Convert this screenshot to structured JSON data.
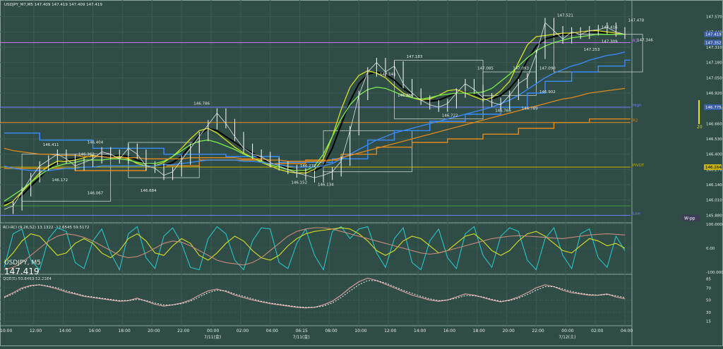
{
  "chart_data": {
    "type": "line",
    "symbol_line": "USDJPY_M7,M5  147.409 147.419 147.409 147.419",
    "symbol": "USDJPY, M5",
    "last_price": "147.419",
    "colors": {
      "background": "#2f4d46",
      "grid": "#3d5a53",
      "text": "#e8ece8",
      "price": "#ffffff",
      "high_line": "#6f7fff",
      "pivot_line": "#c9b400",
      "low_line": "#6f7fff",
      "s_line": "#3d9b3d",
      "r_line": "#c77dff",
      "orange": "#e08a1e",
      "blue": "#3b8cff",
      "cyan": "#27c3c9",
      "yellow": "#d9e021",
      "green": "#7cf04a",
      "black": "#000000",
      "pink": "#d8a0a0"
    },
    "y_axis": {
      "ticks": [
        "147.570",
        "147.440",
        "147.310",
        "147.180",
        "147.050",
        "146.920",
        "146.790",
        "146.660",
        "146.530",
        "146.400",
        "146.270",
        "146.140",
        "146.010",
        "145.880"
      ],
      "ylim": [
        145.84,
        147.64
      ]
    },
    "x_axis": {
      "ticks": [
        "10:00",
        "12:00",
        "14:00",
        "16:00",
        "18:00",
        "20:00",
        "22:00",
        "00:00",
        "02:00",
        "04:00",
        "06:15",
        "08:00",
        "10:00",
        "12:00",
        "14:00",
        "16:00",
        "18:00",
        "20:00",
        "22:00",
        "00:00",
        "02:00",
        "04:00"
      ],
      "date_labels": [
        {
          "text": "7/11(金)",
          "at": 7
        },
        {
          "text": "7/11(金)",
          "at": 10
        },
        {
          "text": "7/12(土)",
          "at": 19
        }
      ]
    },
    "price": [
      145.93,
      145.96,
      146.08,
      146.2,
      146.3,
      146.35,
      146.4,
      146.36,
      146.3,
      146.33,
      146.36,
      146.42,
      146.4,
      146.36,
      146.45,
      146.4,
      146.3,
      146.28,
      146.22,
      146.25,
      146.35,
      146.45,
      146.55,
      146.65,
      146.75,
      146.66,
      146.55,
      146.45,
      146.4,
      146.38,
      146.33,
      146.3,
      146.27,
      146.24,
      146.22,
      146.2,
      146.22,
      146.25,
      146.34,
      146.6,
      146.9,
      147.1,
      147.18,
      147.1,
      147.15,
      147.0,
      146.92,
      146.86,
      146.82,
      146.8,
      146.83,
      146.92,
      147.0,
      146.95,
      146.88,
      146.84,
      146.82,
      146.9,
      147.0,
      147.05,
      147.25,
      147.52,
      147.45,
      147.38,
      147.44,
      147.42,
      147.45,
      147.46,
      147.48,
      147.44,
      147.42
    ],
    "emas": [
      {
        "name": "",
        "color": "#000000",
        "values": [
          145.98,
          146.0,
          146.05,
          146.13,
          146.2,
          146.28,
          146.33,
          146.35,
          146.36,
          146.37,
          146.39,
          146.39,
          146.38,
          146.39,
          146.38,
          146.35,
          146.32,
          146.3,
          146.3,
          146.33,
          146.38,
          146.47,
          146.56,
          146.62,
          146.6,
          146.55,
          146.5,
          146.45,
          146.41,
          146.36,
          146.33,
          146.3,
          146.28,
          146.26,
          146.25,
          146.26,
          146.3,
          146.45,
          146.65,
          146.85,
          147.0,
          147.08,
          147.1,
          147.08,
          147.03,
          146.96,
          146.91,
          146.87,
          146.85,
          146.86,
          146.89,
          146.92,
          146.93,
          146.91,
          146.88,
          146.87,
          146.9,
          146.96,
          147.05,
          147.2,
          147.32,
          147.38,
          147.4,
          147.42,
          147.42,
          147.43,
          147.44,
          147.44,
          147.43,
          147.43,
          147.42
        ]
      },
      {
        "name": "",
        "color": "#d9e021",
        "values": [
          145.96,
          146.0,
          146.08,
          146.16,
          146.24,
          146.3,
          146.34,
          146.34,
          146.35,
          146.37,
          146.39,
          146.38,
          146.37,
          146.38,
          146.36,
          146.32,
          146.3,
          146.3,
          146.33,
          146.38,
          146.45,
          146.53,
          146.6,
          146.62,
          146.58,
          146.52,
          146.46,
          146.41,
          146.37,
          146.33,
          146.3,
          146.27,
          146.25,
          146.24,
          146.24,
          146.27,
          146.36,
          146.55,
          146.78,
          146.97,
          147.07,
          147.11,
          147.09,
          147.05,
          146.98,
          146.92,
          146.88,
          146.86,
          146.87,
          146.9,
          146.94,
          146.95,
          146.92,
          146.89,
          146.86,
          146.88,
          146.94,
          147.02,
          147.18,
          147.33,
          147.4,
          147.41,
          147.42,
          147.43,
          147.43,
          147.44,
          147.45,
          147.45,
          147.44,
          147.43,
          147.42
        ]
      },
      {
        "name": "",
        "color": "#7cf04a",
        "values": [
          146.0,
          146.05,
          146.1,
          146.16,
          146.22,
          146.27,
          146.3,
          146.32,
          146.33,
          146.35,
          146.35,
          146.35,
          146.36,
          146.36,
          146.35,
          146.33,
          146.32,
          146.32,
          146.34,
          146.38,
          146.43,
          146.48,
          146.51,
          146.52,
          146.5,
          146.47,
          146.44,
          146.4,
          146.37,
          146.34,
          146.31,
          146.29,
          146.27,
          146.26,
          146.26,
          146.3,
          146.4,
          146.55,
          146.7,
          146.82,
          146.9,
          146.95,
          146.97,
          146.96,
          146.93,
          146.9,
          146.88,
          146.87,
          146.88,
          146.9,
          146.91,
          146.92,
          146.92,
          146.92,
          146.93,
          146.96,
          147.02,
          147.08,
          147.15,
          147.22,
          147.28,
          147.32,
          147.35,
          147.37,
          147.39,
          147.4,
          147.41,
          147.42,
          147.42,
          147.42,
          147.42
        ]
      },
      {
        "name": "",
        "color": "#3b8cff",
        "values": [
          146.3,
          146.28,
          146.27,
          146.26,
          146.26,
          146.26,
          146.27,
          146.28,
          146.28,
          146.29,
          146.29,
          146.3,
          146.3,
          146.3,
          146.3,
          146.3,
          146.3,
          146.3,
          146.31,
          146.31,
          146.32,
          146.33,
          146.34,
          146.35,
          146.35,
          146.35,
          146.35,
          146.34,
          146.34,
          146.33,
          146.32,
          146.31,
          146.3,
          146.29,
          146.29,
          146.29,
          146.3,
          146.32,
          146.36,
          146.4,
          146.44,
          146.48,
          146.52,
          146.55,
          146.58,
          146.6,
          146.62,
          146.64,
          146.66,
          146.68,
          146.7,
          146.72,
          146.74,
          146.76,
          146.78,
          146.8,
          146.83,
          146.86,
          146.9,
          146.95,
          147.0,
          147.05,
          147.09,
          147.12,
          147.15,
          147.17,
          147.2,
          147.22,
          147.24,
          147.25,
          147.27
        ]
      },
      {
        "name": "",
        "color": "#e08a1e",
        "values": [
          146.45,
          146.43,
          146.42,
          146.41,
          146.4,
          146.4,
          146.39,
          146.39,
          146.39,
          146.38,
          146.38,
          146.38,
          146.37,
          146.37,
          146.37,
          146.37,
          146.36,
          146.36,
          146.36,
          146.36,
          146.36,
          146.37,
          146.37,
          146.37,
          146.37,
          146.37,
          146.37,
          146.36,
          146.36,
          146.36,
          146.35,
          146.35,
          146.34,
          146.34,
          146.34,
          146.34,
          146.34,
          146.35,
          146.37,
          146.39,
          146.41,
          146.43,
          146.45,
          146.47,
          146.49,
          146.51,
          146.53,
          146.55,
          146.57,
          146.59,
          146.61,
          146.63,
          146.65,
          146.67,
          146.69,
          146.71,
          146.73,
          146.75,
          146.77,
          146.79,
          146.81,
          146.83,
          146.85,
          146.87,
          146.88,
          146.9,
          146.92,
          146.93,
          146.94,
          146.95,
          146.96
        ]
      }
    ],
    "step_lines": [
      {
        "color": "#3b8cff",
        "points": [
          [
            0,
            146.58
          ],
          [
            4,
            146.52
          ],
          [
            10,
            146.45
          ],
          [
            18,
            146.4
          ],
          [
            25,
            146.38
          ],
          [
            31,
            146.33
          ],
          [
            37,
            146.36
          ],
          [
            41,
            146.52
          ],
          [
            44,
            146.6
          ],
          [
            48,
            146.68
          ],
          [
            52,
            146.74
          ],
          [
            56,
            146.8
          ],
          [
            59,
            146.92
          ],
          [
            61,
            147.02
          ],
          [
            64,
            147.1
          ],
          [
            67,
            147.15
          ],
          [
            70,
            147.2
          ]
        ]
      },
      {
        "color": "#e08a1e",
        "points": [
          [
            0,
            146.28
          ],
          [
            8,
            146.26
          ],
          [
            16,
            146.3
          ],
          [
            22,
            146.35
          ],
          [
            30,
            146.32
          ],
          [
            34,
            146.35
          ],
          [
            38,
            146.4
          ],
          [
            42,
            146.46
          ],
          [
            46,
            146.5
          ],
          [
            50,
            146.53
          ],
          [
            54,
            146.57
          ],
          [
            58,
            146.62
          ],
          [
            62,
            146.67
          ],
          [
            66,
            146.7
          ],
          [
            70,
            146.7
          ]
        ]
      }
    ],
    "annotations": [
      {
        "text": "146.411",
        "x": 5,
        "y": 146.47
      },
      {
        "text": "146.172",
        "x": 6,
        "y": 146.17
      },
      {
        "text": "146.404",
        "x": 10,
        "y": 146.49
      },
      {
        "text": "146.362",
        "x": 9,
        "y": 146.39
      },
      {
        "text": "146.067",
        "x": 10,
        "y": 146.06
      },
      {
        "text": "146.684",
        "x": 16,
        "y": 146.08
      },
      {
        "text": "146.786",
        "x": 22,
        "y": 146.82
      },
      {
        "text": "146.272",
        "x": 34,
        "y": 146.29
      },
      {
        "text": "146.152",
        "x": 33,
        "y": 146.15
      },
      {
        "text": "146.134",
        "x": 36,
        "y": 146.13
      },
      {
        "text": "147.141",
        "x": 43,
        "y": 147.07
      },
      {
        "text": "146.860",
        "x": 45,
        "y": 146.89
      },
      {
        "text": "147.183",
        "x": 46,
        "y": 147.22
      },
      {
        "text": "146.722",
        "x": 50,
        "y": 146.72
      },
      {
        "text": "147.085",
        "x": 54,
        "y": 147.12
      },
      {
        "text": "146.766",
        "x": 56,
        "y": 146.76
      },
      {
        "text": "147.093",
        "x": 58,
        "y": 147.12
      },
      {
        "text": "146.789",
        "x": 59,
        "y": 146.78
      },
      {
        "text": "147.090",
        "x": 61,
        "y": 147.12
      },
      {
        "text": "146.902",
        "x": 61,
        "y": 146.92
      },
      {
        "text": "147.521",
        "x": 63,
        "y": 147.57
      },
      {
        "text": "147.253",
        "x": 66,
        "y": 147.28
      },
      {
        "text": "147.416",
        "x": 68,
        "y": 147.47
      },
      {
        "text": "147.309",
        "x": 68,
        "y": 147.35
      },
      {
        "text": "147.478",
        "x": 71,
        "y": 147.53
      },
      {
        "text": "147.346",
        "x": 72,
        "y": 147.36
      }
    ],
    "levels": [
      {
        "label": "R2",
        "value": 147.35,
        "color": "#c77dff"
      },
      {
        "label": "High",
        "value": 146.8,
        "color": "#6f7fff"
      },
      {
        "label": "R2",
        "value": 146.67,
        "color": "#e08a1e"
      },
      {
        "label": "PIVOT",
        "value": 146.29,
        "color": "#c9b400"
      },
      {
        "label": "Low",
        "value": 145.88,
        "color": "#6f7fff"
      },
      {
        "label": "",
        "value": 145.96,
        "color": "#3d9b3d"
      }
    ],
    "right_tags": [
      {
        "text": "147.419",
        "value": 147.42
      },
      {
        "text": "147.352",
        "value": 147.35
      },
      {
        "text": "146.775",
        "value": 146.8
      },
      {
        "text": "146.264",
        "value": 146.29
      }
    ],
    "w_pp_label": "W-pp",
    "level_20_label": "20",
    "rci_panel": {
      "title": "RCI-RCI (9,26,52) 13.1322 -12.6545 59.5172",
      "ticks": [
        "100.0000",
        "0.00",
        "-100.0000"
      ],
      "ylim": [
        -100,
        100
      ]
    },
    "qqe_panel": {
      "title": "QQE(5) 50.8463 52.2184",
      "ticks": [
        "85",
        "70",
        "50",
        "30",
        "15"
      ],
      "ylim": [
        10,
        90
      ],
      "line": [
        55,
        62,
        70,
        74,
        75,
        72,
        68,
        63,
        60,
        56,
        54,
        52,
        50,
        48,
        49,
        53,
        48,
        43,
        40,
        42,
        45,
        50,
        58,
        65,
        68,
        64,
        58,
        54,
        50,
        47,
        44,
        42,
        40,
        38,
        37,
        38,
        42,
        48,
        58,
        70,
        80,
        86,
        82,
        76,
        70,
        64,
        58,
        54,
        50,
        48,
        50,
        55,
        60,
        58,
        54,
        50,
        47,
        50,
        55,
        62,
        70,
        75,
        72,
        66,
        62,
        60,
        58,
        58,
        60,
        55,
        52
      ],
      "signal": [
        54,
        60,
        68,
        73,
        75,
        73,
        70,
        65,
        61,
        57,
        55,
        53,
        51,
        49,
        49,
        51,
        49,
        45,
        42,
        42,
        44,
        48,
        55,
        62,
        66,
        65,
        60,
        56,
        52,
        48,
        45,
        43,
        41,
        39,
        38,
        38,
        40,
        45,
        54,
        65,
        75,
        82,
        82,
        78,
        72,
        66,
        61,
        56,
        52,
        49,
        50,
        53,
        57,
        57,
        55,
        51,
        48,
        49,
        53,
        59,
        66,
        72,
        72,
        68,
        64,
        61,
        59,
        58,
        59,
        57,
        54
      ]
    },
    "rci_series": {
      "cyan": [
        -80,
        60,
        80,
        -50,
        -90,
        40,
        85,
        70,
        -60,
        -85,
        30,
        80,
        -20,
        -90,
        60,
        90,
        -40,
        -85,
        50,
        85,
        20,
        -80,
        -90,
        40,
        90,
        60,
        -50,
        -90,
        30,
        85,
        80,
        -60,
        -85,
        20,
        80,
        -30,
        -90,
        70,
        90,
        40,
        80,
        90,
        -20,
        -80,
        40,
        85,
        -60,
        -90,
        30,
        80,
        -40,
        -85,
        60,
        90,
        -30,
        -80,
        50,
        85,
        70,
        -50,
        -90,
        40,
        85,
        -30,
        -85,
        60,
        80,
        -40,
        -80,
        50,
        -10
      ],
      "yellow": [
        -60,
        -20,
        30,
        60,
        50,
        10,
        -30,
        -20,
        20,
        40,
        20,
        -20,
        -40,
        -10,
        40,
        60,
        30,
        -20,
        -30,
        10,
        40,
        20,
        -30,
        -50,
        -20,
        20,
        50,
        30,
        -10,
        -40,
        -50,
        -30,
        10,
        40,
        60,
        70,
        75,
        80,
        85,
        80,
        60,
        30,
        -10,
        -30,
        -10,
        30,
        50,
        40,
        10,
        -20,
        -10,
        20,
        50,
        60,
        30,
        -10,
        -30,
        -10,
        30,
        60,
        70,
        50,
        20,
        -10,
        -20,
        10,
        40,
        30,
        10,
        20,
        0
      ],
      "pink": [
        -90,
        -80,
        -60,
        -30,
        0,
        30,
        50,
        60,
        55,
        45,
        30,
        10,
        -10,
        -30,
        -40,
        -35,
        -20,
        0,
        20,
        30,
        25,
        10,
        -10,
        -30,
        -50,
        -60,
        -65,
        -70,
        -60,
        -40,
        -10,
        20,
        50,
        70,
        80,
        85,
        85,
        80,
        70,
        60,
        50,
        40,
        30,
        20,
        10,
        0,
        -10,
        -20,
        -25,
        -20,
        -10,
        0,
        10,
        20,
        30,
        40,
        45,
        50,
        52,
        50,
        48,
        45,
        42,
        40,
        45,
        50,
        55,
        58,
        60,
        58,
        55
      ]
    }
  }
}
